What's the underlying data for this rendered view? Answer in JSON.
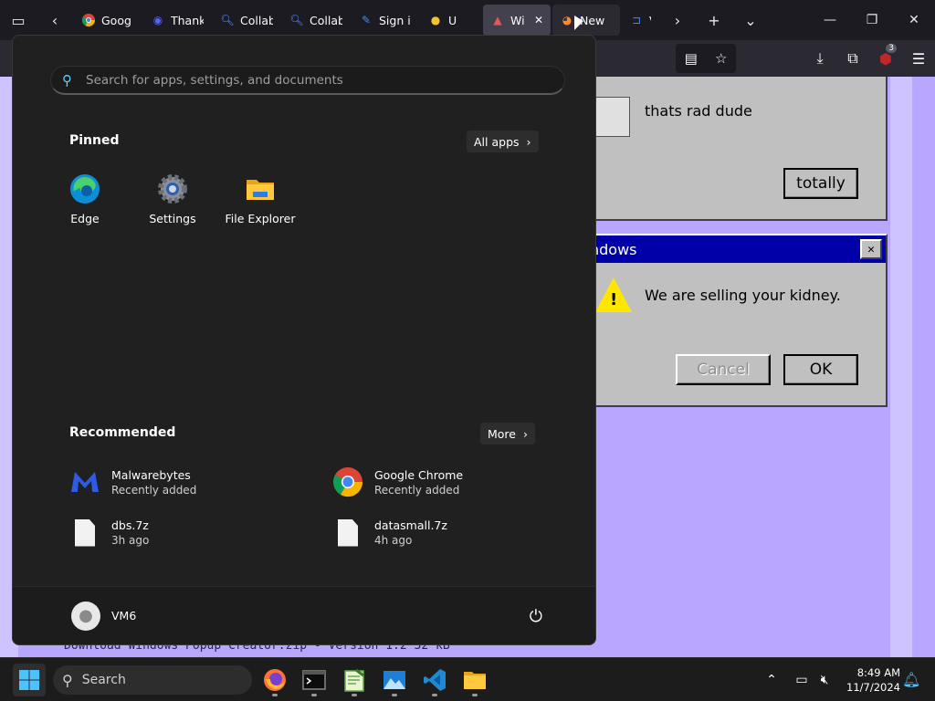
{
  "browser": {
    "tabs": [
      {
        "label": "Goog",
        "icon": "chrome-icon"
      },
      {
        "label": "Thank",
        "icon": "discord-icon"
      },
      {
        "label": "Collab",
        "icon": "search-icon"
      },
      {
        "label": "Collab",
        "icon": "search-icon"
      },
      {
        "label": "Sign i",
        "icon": "sign-icon"
      },
      {
        "label": "U",
        "icon": "bell-icon"
      },
      {
        "label": "Wi",
        "icon": "hat-icon",
        "active": true
      },
      {
        "label": "New",
        "icon": "firefox-icon"
      },
      {
        "label": "V",
        "icon": "vscode-icon"
      }
    ],
    "extension_badge": "3"
  },
  "page": {
    "dialog1": {
      "message": "thats rad dude",
      "button": "totally"
    },
    "dialog2": {
      "title": "ndows",
      "message": "We are selling your kidney.",
      "cancel": "Cancel",
      "ok": "OK"
    },
    "download_line": "Download    Windows Popup Creator.zip - Version 1.2  32 kB"
  },
  "start_menu": {
    "search_placeholder": "Search for apps, settings, and documents",
    "pinned_title": "Pinned",
    "all_apps": "All apps",
    "pinned": [
      {
        "label": "Edge"
      },
      {
        "label": "Settings"
      },
      {
        "label": "File Explorer"
      }
    ],
    "recommended_title": "Recommended",
    "more": "More",
    "recommended": [
      {
        "name": "Malwarebytes",
        "sub": "Recently added"
      },
      {
        "name": "Google Chrome",
        "sub": "Recently added"
      },
      {
        "name": "dbs.7z",
        "sub": "3h ago"
      },
      {
        "name": "datasmall.7z",
        "sub": "4h ago"
      }
    ],
    "user": "VM6"
  },
  "taskbar": {
    "search_label": "Search",
    "time": "8:49 AM",
    "date": "11/7/2024"
  }
}
